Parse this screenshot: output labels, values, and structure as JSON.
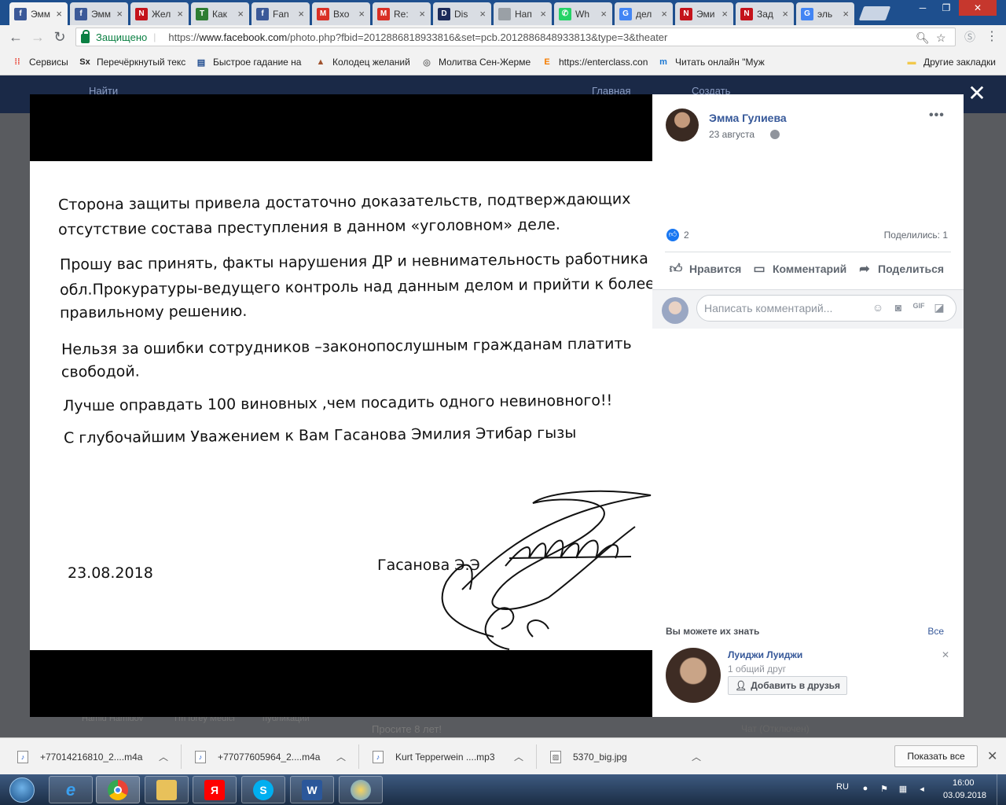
{
  "browser": {
    "tabs": [
      {
        "label": "Эмм",
        "favicon": "facebook-icon",
        "color": "#3b5998",
        "glyph": "f",
        "active": true
      },
      {
        "label": "Эмм",
        "favicon": "facebook-icon",
        "color": "#3b5998",
        "glyph": "f"
      },
      {
        "label": "Жел",
        "favicon": "n-icon",
        "color": "#c4131b",
        "glyph": "N"
      },
      {
        "label": "Как",
        "favicon": "tree-icon",
        "color": "#2e7d32",
        "glyph": "T"
      },
      {
        "label": "Fan",
        "favicon": "facebook-icon",
        "color": "#3b5998",
        "glyph": "f"
      },
      {
        "label": "Вхо",
        "favicon": "gmail-icon",
        "color": "#d93025",
        "glyph": "M"
      },
      {
        "label": "Re:",
        "favicon": "gmail-icon",
        "color": "#d93025",
        "glyph": "M"
      },
      {
        "label": "Dis",
        "favicon": "d-icon",
        "color": "#1c2b5a",
        "glyph": "D"
      },
      {
        "label": "Нап",
        "favicon": "page-icon",
        "color": "#9aa0a6",
        "glyph": ""
      },
      {
        "label": "Wh",
        "favicon": "whatsapp-icon",
        "color": "#25d366",
        "glyph": "✆"
      },
      {
        "label": "дел",
        "favicon": "google-icon",
        "color": "#4285f4",
        "glyph": "G"
      },
      {
        "label": "Эми",
        "favicon": "n-icon",
        "color": "#c4131b",
        "glyph": "N"
      },
      {
        "label": "Зад",
        "favicon": "n-icon",
        "color": "#c4131b",
        "glyph": "N"
      },
      {
        "label": "эль",
        "favicon": "google-icon",
        "color": "#4285f4",
        "glyph": "G"
      }
    ],
    "secure_label": "Защищено",
    "url_scheme": "https://",
    "url_host": "www.facebook.com",
    "url_path": "/photo.php?fbid=2012886818933816&set=pcb.2012886848933813&type=3&theater",
    "bookmarks": [
      {
        "label": "Сервисы",
        "icon": "apps-grid-icon",
        "glyph": "⁞⁞",
        "color": "#e94235"
      },
      {
        "label": "Перечёркнутый текс",
        "icon": "sx-icon",
        "glyph": "Sx",
        "color": "#222"
      },
      {
        "label": "Быстрое гадание на",
        "icon": "cards-icon",
        "glyph": "▤",
        "color": "#1f4b8f"
      },
      {
        "label": "Колодец желаний",
        "icon": "well-icon",
        "glyph": "▲",
        "color": "#a0522d"
      },
      {
        "label": "Молитва Сен-Жерме",
        "icon": "globe-icon",
        "glyph": "◎",
        "color": "#777"
      },
      {
        "label": "https://enterclass.con",
        "icon": "e-icon",
        "glyph": "E",
        "color": "#f57c00"
      },
      {
        "label": "Читать онлайн \"Муж",
        "icon": "m-icon",
        "glyph": "m",
        "color": "#1976d2"
      },
      {
        "label": "Другие закладки",
        "icon": "folder-icon",
        "glyph": "▬",
        "color": "#f2c94c"
      }
    ]
  },
  "letter": {
    "paragraphs": [
      "Сторона защиты привела достаточно доказательств, подтверждающих",
      "отсутствие состава преступления в данном «уголовном» деле.",
      "Прошу вас принять, факты нарушения ДР и невнимательность работника",
      "обл.Прокуратуры-ведущего контроль над данным делом и прийти к более",
      "правильному решению.",
      "Нельзя за ошибки сотрудников –законопослушным гражданам платить",
      "свободой.",
      "Лучше оправдать 100 виновных ,чем посадить одного невиновного!!",
      "С глубочайшим Уважением к Вам Гасанова Эмилия Этибар гызы"
    ],
    "date": "23.08.2018",
    "signer": "Гасанова Э.Э"
  },
  "post": {
    "author": "Эмма Гулиева",
    "date": "23 августа",
    "like_count": "2",
    "shares": "Поделились: 1",
    "actions": {
      "like": "Нравится",
      "comment": "Комментарий",
      "share": "Поделиться"
    },
    "comment_placeholder": "Написать комментарий..."
  },
  "pymk": {
    "title": "Вы можете их знать",
    "see_all": "Все",
    "name": "Луиджи Луиджи",
    "mutual": "1 общий друг",
    "add_label": "Добавить в друзья"
  },
  "background": {
    "fb_bits": [
      "Hamid Hamidov",
      "I'm forey Medici",
      "публикации",
      "Просите 8 лет!",
      "Чат (Отключен)",
      "Найти",
      "Главная",
      "Создать"
    ]
  },
  "downloads": {
    "items": [
      {
        "name": "+77014216810_2....m4a",
        "icon": "audio-file-icon"
      },
      {
        "name": "+77077605964_2....m4a",
        "icon": "audio-file-icon"
      },
      {
        "name": "Kurt Tepperwein ....mp3",
        "icon": "audio-file-icon"
      },
      {
        "name": "5370_big.jpg",
        "icon": "image-file-icon"
      }
    ],
    "show_all": "Показать все"
  },
  "taskbar": {
    "lang": "RU",
    "time": "16:00",
    "date": "03.09.2018"
  }
}
